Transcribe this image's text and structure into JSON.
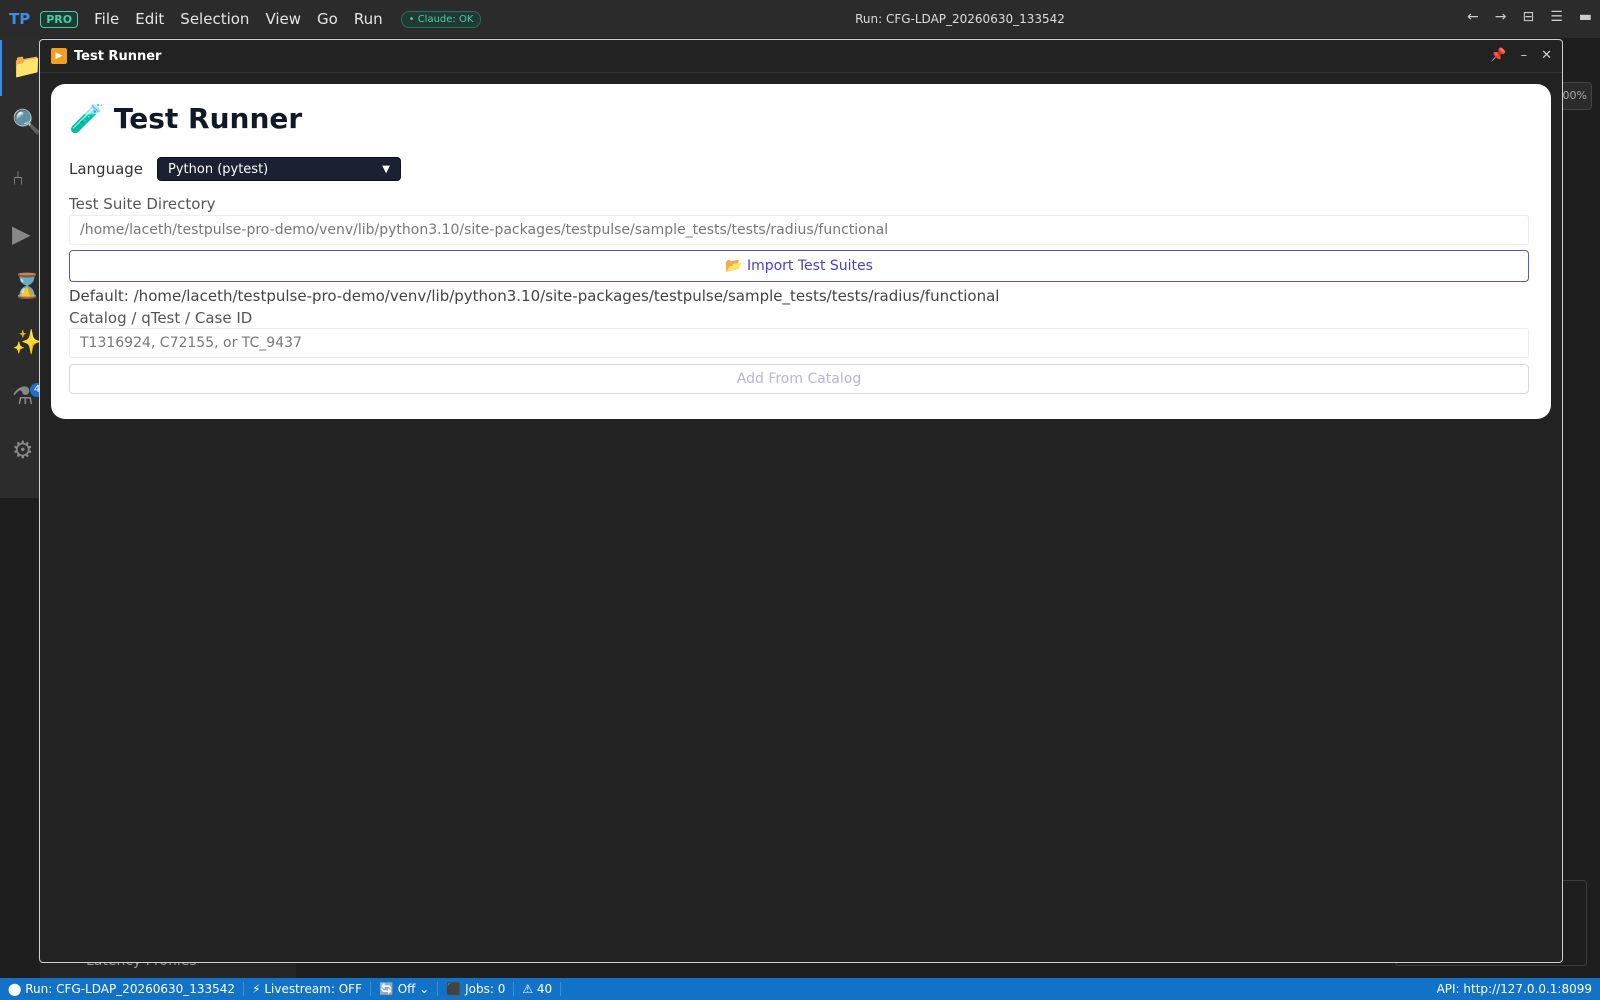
{
  "app": {
    "logo": "TP",
    "badge": "PRO",
    "menus": [
      "File",
      "Edit",
      "Selection",
      "View",
      "Go",
      "Run"
    ],
    "claude_status": "• Claude: OK",
    "run_title": "Run: CFG-LDAP_20260630_133542",
    "nav_back": "←",
    "nav_forward": "→",
    "layout_icon": "⊟",
    "menu_icon": "☰",
    "panel_icon": "▬"
  },
  "activity": {
    "icons": [
      "folder-icon",
      "search-icon",
      "branch-icon",
      "run-icon",
      "hourglass-icon",
      "sparkle-icon",
      "flask-icon",
      "gear-icon"
    ],
    "badge": "4"
  },
  "background": {
    "latency_label": "Latency Profiles",
    "zoom": "00%"
  },
  "window": {
    "title": "Test Runner",
    "pin": "📌",
    "minimize": "–",
    "close": "✕"
  },
  "runner": {
    "heading": "Test Runner",
    "language_label": "Language",
    "language_value": "Python (pytest)",
    "suite_dir_label": "Test Suite Directory",
    "suite_dir_placeholder": "/home/laceth/testpulse-pro-demo/venv/lib/python3.10/site-packages/testpulse/sample_tests/tests/radius/functional",
    "import_button": "📂 Import Test Suites",
    "default_text": "Default: /home/laceth/testpulse-pro-demo/venv/lib/python3.10/site-packages/testpulse/sample_tests/tests/radius/functional",
    "catalog_label": "Catalog / qTest / Case ID",
    "catalog_placeholder": "T1316924, C72155, or TC_9437",
    "catalog_button": "Add From Catalog"
  },
  "status": {
    "run": "⬤ Run: CFG-LDAP_20260630_133542",
    "livestream": "⚡ Livestream: OFF",
    "refresh": "🔄  Off  ⌄",
    "jobs": "⬛ Jobs: 0",
    "warnings": "⚠ 40",
    "api": "API: http://127.0.0.1:8099"
  }
}
